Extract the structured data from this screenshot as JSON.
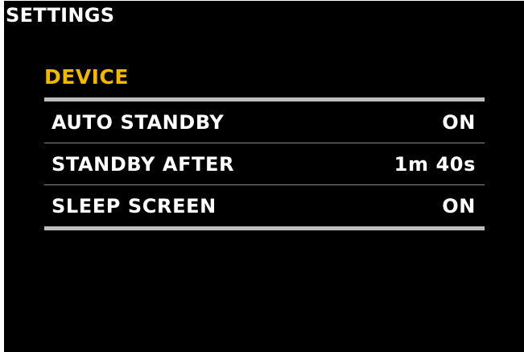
{
  "screen": {
    "title": "SETTINGS"
  },
  "section": {
    "title": "DEVICE",
    "rows": [
      {
        "label": "AUTO STANDBY",
        "value": "ON"
      },
      {
        "label": "STANDBY AFTER",
        "value": "1m 40s"
      },
      {
        "label": "SLEEP SCREEN",
        "value": "ON"
      }
    ]
  },
  "colors": {
    "background": "#000000",
    "text": "#ffffff",
    "section_accent": "#f2b800",
    "rule": "#bdbdbd"
  }
}
